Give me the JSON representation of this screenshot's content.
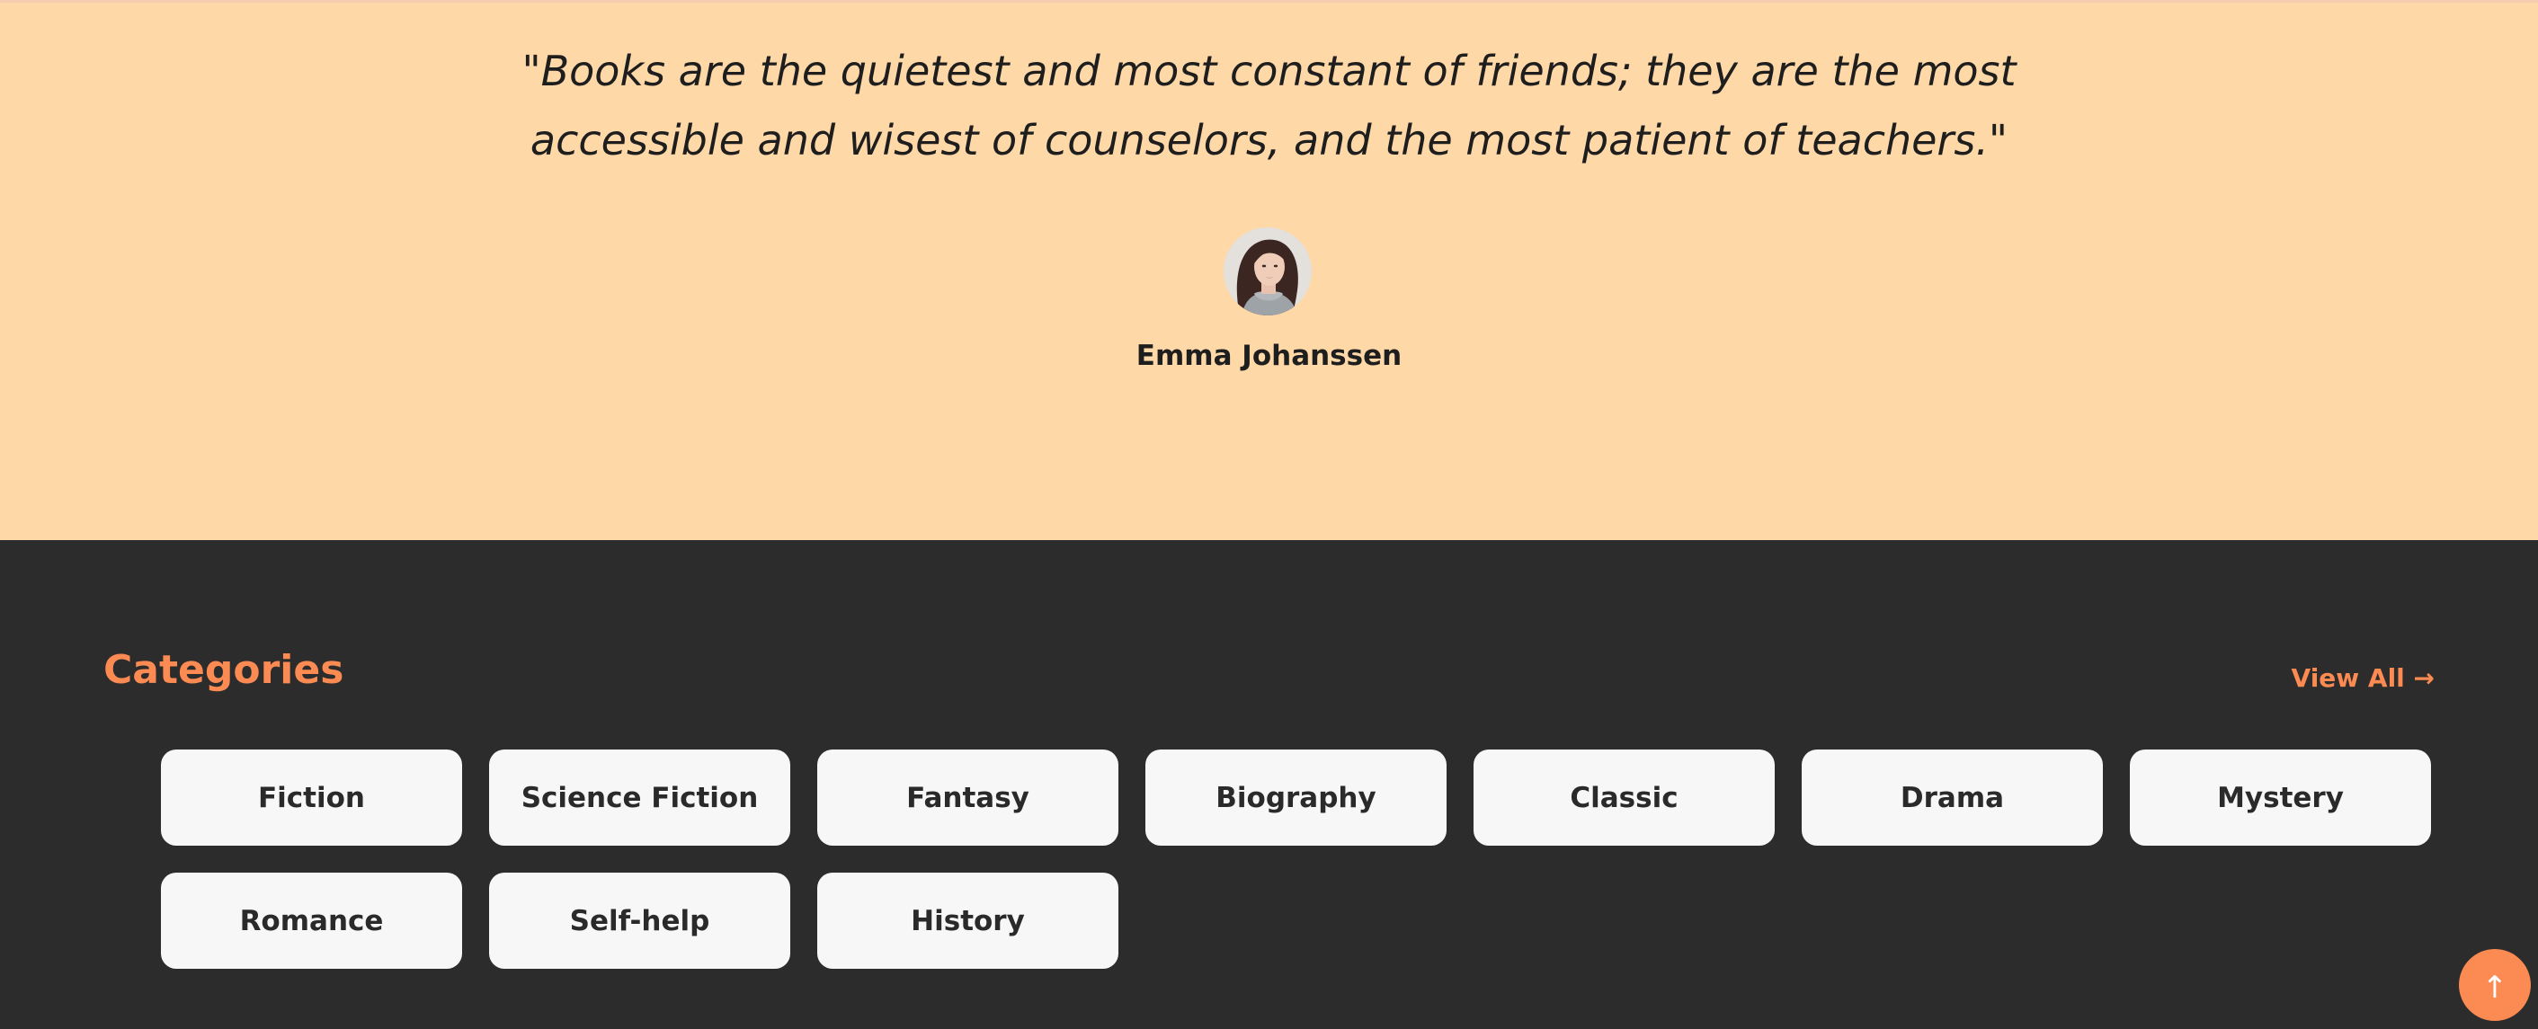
{
  "testimonial": {
    "quote_line1": "\"Books are the quietest and most constant of friends; they are the most",
    "quote_line2": "accessible and wisest of counselors, and the most patient of teachers.\"",
    "author_name": "Emma Johanssen",
    "background_color": "#ffd8a8"
  },
  "categories": {
    "title": "Categories",
    "view_all_label": "View All →",
    "items": [
      {
        "label": "Fiction"
      },
      {
        "label": "Science Fiction"
      },
      {
        "label": "Fantasy"
      },
      {
        "label": "Biography"
      },
      {
        "label": "Classic"
      },
      {
        "label": "Drama"
      },
      {
        "label": "Mystery"
      },
      {
        "label": "Romance"
      },
      {
        "label": "Self-help"
      },
      {
        "label": "History"
      }
    ],
    "background_color": "#2c2c2c",
    "accent_color": "#fb8b52"
  },
  "scroll_top": {
    "icon": "arrow-up-icon",
    "glyph": "↑"
  }
}
